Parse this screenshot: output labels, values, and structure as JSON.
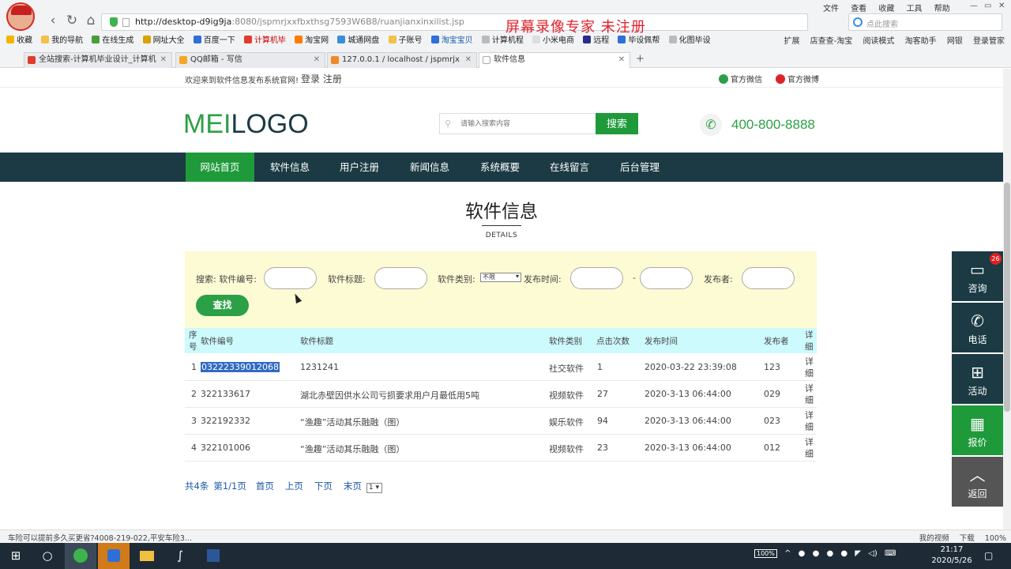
{
  "browser": {
    "url_host": "http://desktop-d9ig9ja",
    "url_rest": ":8080/jspmrjxxfbxthsg7593W6B8/ruanjianxinxilist.jsp",
    "watermark": "屏幕录像专家 未注册",
    "menus": [
      "文件",
      "查看",
      "收藏",
      "工具",
      "帮助"
    ],
    "search_placeholder": "点此搜索",
    "bookmarks": [
      "收藏",
      "我的导航",
      "在线生成",
      "网址大全",
      "百度一下",
      "计算机毕",
      "淘宝网",
      "城通网盘",
      "子账号",
      "淘宝宝贝",
      "计算机程",
      "小米电商",
      "远程",
      "毕设佩帮",
      "化图毕设"
    ],
    "bookmarks_right": [
      "扩展",
      "店查查-淘宝",
      "阅读模式",
      "淘客助手",
      "网银",
      "登录管家"
    ],
    "tabs": [
      {
        "label": "全站搜索-计算机毕业设计_计算机",
        "color": "#e23b2e"
      },
      {
        "label": "QQ邮箱 - 写信",
        "color": "#f5a623"
      },
      {
        "label": "127.0.0.1 / localhost / jspmrjx",
        "color": "#f08a24"
      },
      {
        "label": "软件信息",
        "color": "#999999"
      }
    ]
  },
  "topbar": {
    "welcome": "欢迎来到软件信息发布系统官网!",
    "login_register": "登录 注册",
    "wechat": "官方微信",
    "weibo": "官方微博"
  },
  "header": {
    "logo_green": "MEI",
    "logo_dark": "LOGO",
    "search_placeholder": "请输入搜索内容",
    "search_button": "搜索",
    "phone": "400-800-8888"
  },
  "nav": [
    "网站首页",
    "软件信息",
    "用户注册",
    "新闻信息",
    "系统概要",
    "在线留言",
    "后台管理"
  ],
  "page": {
    "title": "软件信息",
    "subtitle": "DETAILS"
  },
  "filters": {
    "search_label": "搜索: 软件编号:",
    "title_label": "软件标题:",
    "category_label": "软件类别:",
    "category_value": "不限",
    "time_label": "发布时间:",
    "dash": "-",
    "publisher_label": "发布者:",
    "search_button": "查找"
  },
  "table": {
    "headers": {
      "index": "序号",
      "code": "软件编号",
      "title": "软件标题",
      "category": "软件类别",
      "clicks": "点击次数",
      "time": "发布时间",
      "publisher": "发布者",
      "detail": "详细"
    },
    "rows": [
      {
        "index": "1",
        "code": "03222339012068",
        "title": "1231241",
        "category": "社交软件",
        "clicks": "1",
        "time": "2020-03-22 23:39:08",
        "publisher": "123",
        "detail": "详细"
      },
      {
        "index": "2",
        "code": "322133617",
        "title": "湖北赤壁因供水公司亏损要求用户月最低用5吨",
        "category": "视频软件",
        "clicks": "27",
        "time": "2020-3-13 06:44:00",
        "publisher": "029",
        "detail": "详细"
      },
      {
        "index": "3",
        "code": "322192332",
        "title": "“渔趣”活动其乐融融（图）",
        "category": "娱乐软件",
        "clicks": "94",
        "time": "2020-3-13 06:44:00",
        "publisher": "023",
        "detail": "详细"
      },
      {
        "index": "4",
        "code": "322101006",
        "title": "“渔趣”活动其乐融融（图）",
        "category": "视频软件",
        "clicks": "23",
        "time": "2020-3-13 06:44:00",
        "publisher": "012",
        "detail": "详细"
      }
    ]
  },
  "pager": {
    "count": "共4条",
    "page_info": "第1/1页",
    "first": "首页",
    "prev": "上页",
    "next": "下页",
    "last": "末页",
    "current": "1"
  },
  "float_menu": [
    {
      "label": "咨询",
      "icon": "chat-icon",
      "badge": "26"
    },
    {
      "label": "电话",
      "icon": "phone-icon"
    },
    {
      "label": "活动",
      "icon": "gift-icon"
    },
    {
      "label": "报价",
      "icon": "calculator-icon"
    },
    {
      "label": "返回",
      "icon": "chevron-up-icon"
    }
  ],
  "statusbar": {
    "ticker": "车险可以提前多久买更省?4008-219-022,平安车险3...",
    "items": [
      "我的视频",
      "下载",
      "100%"
    ]
  },
  "taskbar": {
    "battery": "100%",
    "time": "21:17",
    "date": "2020/5/26"
  }
}
